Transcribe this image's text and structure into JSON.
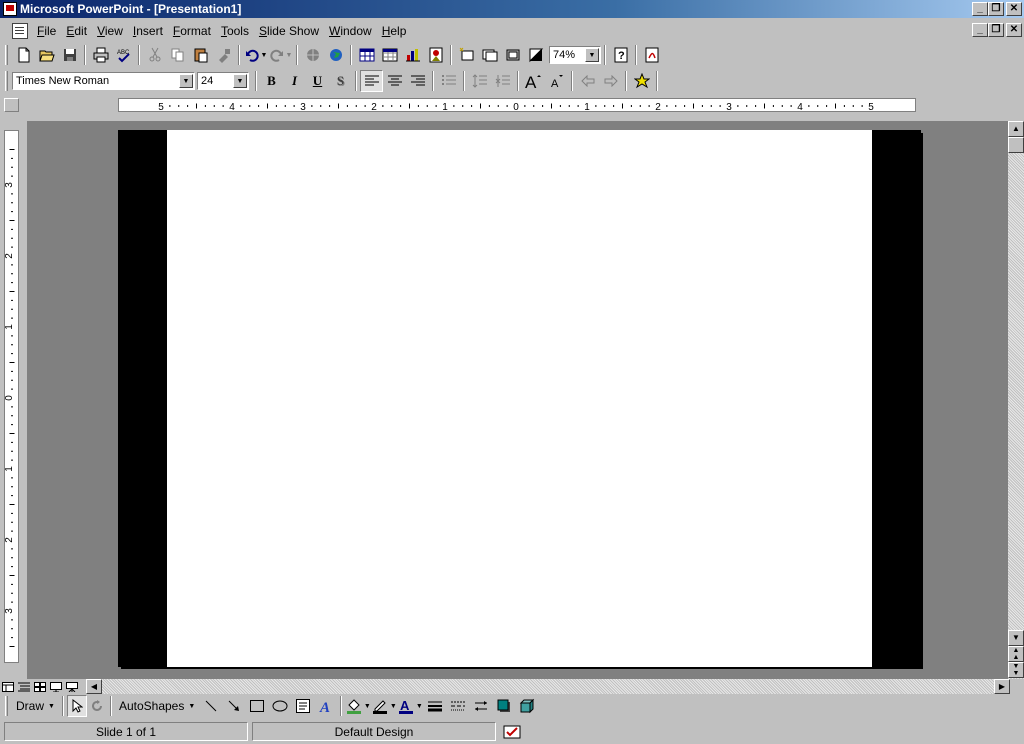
{
  "window": {
    "title": "Microsoft PowerPoint - [Presentation1]",
    "minimize": "_",
    "restore": "❐",
    "close": "✕"
  },
  "menu": {
    "items": [
      "File",
      "Edit",
      "View",
      "Insert",
      "Format",
      "Tools",
      "Slide Show",
      "Window",
      "Help"
    ]
  },
  "standard_toolbar": {
    "zoom": "74%"
  },
  "formatting_toolbar": {
    "font_name": "Times New Roman",
    "font_size": "24",
    "bold": "B",
    "italic": "I",
    "underline": "U",
    "shadow": "S"
  },
  "ruler": {
    "h_labels": [
      "5",
      "4",
      "3",
      "2",
      "1",
      "0",
      "1",
      "2",
      "3",
      "4",
      "5"
    ],
    "v_labels": [
      "3",
      "2",
      "1",
      "0",
      "1",
      "2",
      "3"
    ]
  },
  "drawing_toolbar": {
    "draw": "Draw",
    "autoshapes": "AutoShapes"
  },
  "status": {
    "slide": "Slide 1 of 1",
    "design": "Default Design"
  },
  "colors": {
    "titlebar_start": "#0a246a",
    "titlebar_end": "#a6caf0",
    "face": "#c0c0c0",
    "workspace": "#808080",
    "slide": "#ffffff"
  }
}
